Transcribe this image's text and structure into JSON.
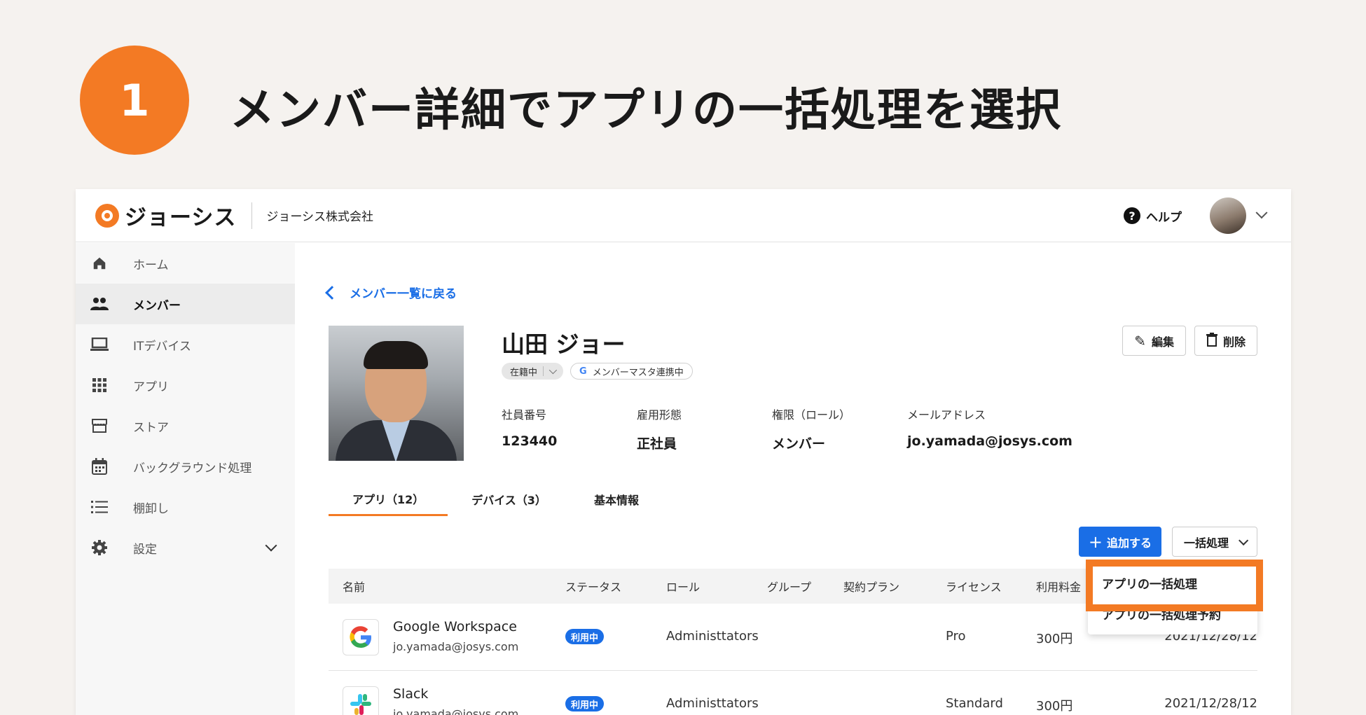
{
  "step": {
    "number": "1",
    "title": "メンバー詳細でアプリの一括処理を選択"
  },
  "header": {
    "logo": "ジョーシス",
    "company": "ジョーシス株式会社",
    "help": "ヘルプ"
  },
  "sidebar": {
    "items": [
      {
        "label": "ホーム",
        "icon": "home-icon"
      },
      {
        "label": "メンバー",
        "icon": "people-icon"
      },
      {
        "label": "ITデバイス",
        "icon": "laptop-icon"
      },
      {
        "label": "アプリ",
        "icon": "grid-icon"
      },
      {
        "label": "ストア",
        "icon": "store-icon"
      },
      {
        "label": "バックグラウンド処理",
        "icon": "calendar-icon"
      },
      {
        "label": "棚卸し",
        "icon": "list-icon"
      },
      {
        "label": "設定",
        "icon": "gear-icon"
      }
    ]
  },
  "main": {
    "back": "メンバー一覧に戻る",
    "member": {
      "name": "山田 ジョー",
      "status": "在籍中",
      "sync": "メンバーマスタ連携中",
      "fields": [
        {
          "label": "社員番号",
          "value": "123440"
        },
        {
          "label": "雇用形態",
          "value": "正社員"
        },
        {
          "label": "権限（ロール）",
          "value": "メンバー"
        },
        {
          "label": "メールアドレス",
          "value": "jo.yamada@josys.com"
        }
      ]
    },
    "actions": {
      "edit": "編集",
      "delete": "削除"
    },
    "tabs": [
      "アプリ（12）",
      "デバイス（3）",
      "基本情報"
    ],
    "add_button": "追加する",
    "bulk_button": "一括処理",
    "dropdown": [
      "アプリの一括処理",
      "アプリの一括処理予約"
    ],
    "table": {
      "headers": [
        "名前",
        "ステータス",
        "ロール",
        "グループ",
        "契約プラン",
        "ライセンス",
        "利用料金"
      ],
      "rows": [
        {
          "name": "Google Workspace",
          "email": "jo.yamada@josys.com",
          "status": "利用中",
          "role": "Administtators",
          "license": "Pro",
          "fee": "300円",
          "date": "2021/12/28/12"
        },
        {
          "name": "Slack",
          "email": "jo.yamada@josys.com",
          "status": "利用中",
          "role": "Administtators",
          "license": "Standard",
          "fee": "300円",
          "date": "2021/12/28/12"
        }
      ]
    }
  },
  "colors": {
    "accent": "#f37a24",
    "primary": "#1a6ee6"
  }
}
